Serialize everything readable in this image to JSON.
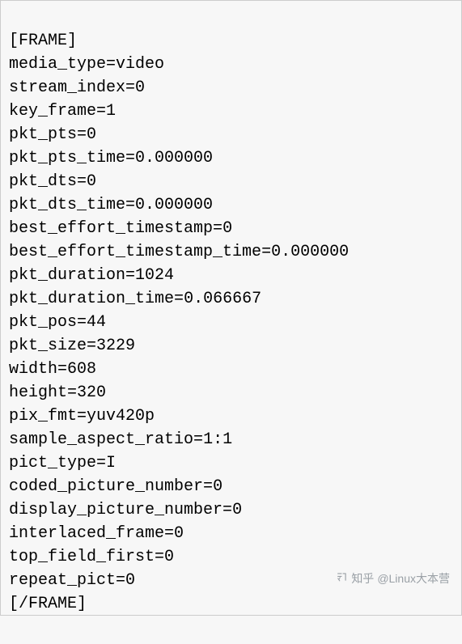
{
  "frame_header": "[FRAME]",
  "frame_footer": "[/FRAME]",
  "fields": [
    {
      "key": "media_type",
      "value": "video"
    },
    {
      "key": "stream_index",
      "value": "0"
    },
    {
      "key": "key_frame",
      "value": "1"
    },
    {
      "key": "pkt_pts",
      "value": "0"
    },
    {
      "key": "pkt_pts_time",
      "value": "0.000000"
    },
    {
      "key": "pkt_dts",
      "value": "0"
    },
    {
      "key": "pkt_dts_time",
      "value": "0.000000"
    },
    {
      "key": "best_effort_timestamp",
      "value": "0"
    },
    {
      "key": "best_effort_timestamp_time",
      "value": "0.000000"
    },
    {
      "key": "pkt_duration",
      "value": "1024"
    },
    {
      "key": "pkt_duration_time",
      "value": "0.066667"
    },
    {
      "key": "pkt_pos",
      "value": "44"
    },
    {
      "key": "pkt_size",
      "value": "3229"
    },
    {
      "key": "width",
      "value": "608"
    },
    {
      "key": "height",
      "value": "320"
    },
    {
      "key": "pix_fmt",
      "value": "yuv420p"
    },
    {
      "key": "sample_aspect_ratio",
      "value": "1:1"
    },
    {
      "key": "pict_type",
      "value": "I"
    },
    {
      "key": "coded_picture_number",
      "value": "0"
    },
    {
      "key": "display_picture_number",
      "value": "0"
    },
    {
      "key": "interlaced_frame",
      "value": "0"
    },
    {
      "key": "top_field_first",
      "value": "0"
    },
    {
      "key": "repeat_pict",
      "value": "0"
    }
  ],
  "watermark": {
    "prefix": "知乎",
    "author": "@Linux大本营"
  }
}
